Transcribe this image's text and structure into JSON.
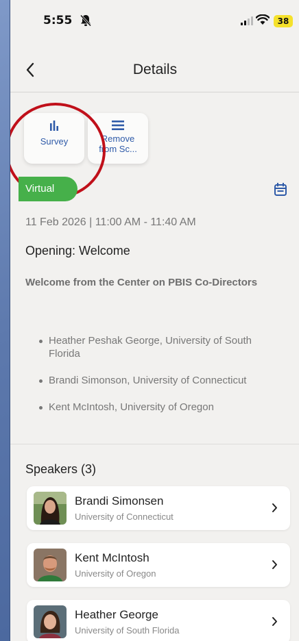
{
  "status_bar": {
    "time": "5:55",
    "battery": "38"
  },
  "nav": {
    "title": "Details"
  },
  "actions": {
    "survey_label": "Survey",
    "remove_label_line1": "Remove",
    "remove_label_line2": "from Sc..."
  },
  "session": {
    "badge": "Virtual",
    "date_time": "11 Feb 2026 | 11:00 AM - 11:40 AM",
    "title": "Opening: Welcome",
    "description": "Welcome from the Center on PBIS Co-Directors",
    "directors": [
      "Heather Peshak George, University of South Florida",
      "Brandi Simonson, University of Connecticut",
      "Kent McIntosh, University of Oregon"
    ]
  },
  "speakers": {
    "heading": "Speakers (3)",
    "items": [
      {
        "name": "Brandi Simonsen",
        "org": "University of Connecticut"
      },
      {
        "name": "Kent McIntosh",
        "org": "University of Oregon"
      },
      {
        "name": "Heather George",
        "org": "University of South Florida"
      }
    ]
  },
  "colors": {
    "accent": "#2e5aa8",
    "badge_green": "#46b04a",
    "annotation_red": "#c0101a",
    "battery_yellow": "#f5e12b"
  },
  "icons": {
    "bell": "bell-slash-icon",
    "signal": "signal-icon",
    "wifi": "wifi-icon",
    "back": "chevron-left-icon",
    "survey": "bar-chart-icon",
    "remove": "list-icon",
    "calendar": "calendar-icon",
    "speaker_chevron": "chevron-right-icon"
  }
}
